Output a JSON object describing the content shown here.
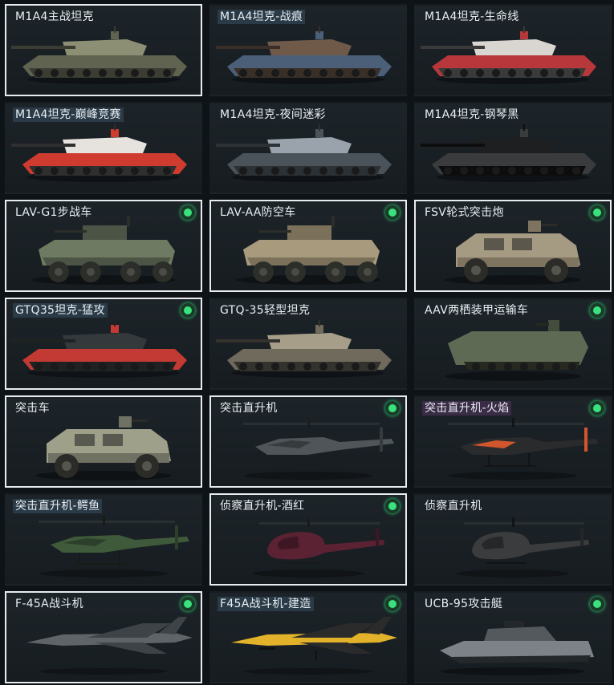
{
  "vehicles": [
    {
      "name": "M1A4主战坦克",
      "owned": true,
      "kind": "tank",
      "colors": [
        "#8c8f74",
        "#5f6350",
        "#3b3d33"
      ]
    },
    {
      "name": "M1A4坦克-战痕",
      "owned": false,
      "tag": "blue",
      "kind": "tank",
      "colors": [
        "#6f5a4a",
        "#4b5f78",
        "#3a2f28"
      ]
    },
    {
      "name": "M1A4坦克-生命线",
      "owned": false,
      "kind": "tank",
      "colors": [
        "#d9d5d0",
        "#b8373a",
        "#3a3a3a"
      ]
    },
    {
      "name": "M1A4坦克-巅峰竞赛",
      "owned": false,
      "tag": "blue",
      "kind": "tank",
      "colors": [
        "#e6e3df",
        "#cf3b2e",
        "#2f2f2f"
      ]
    },
    {
      "name": "M1A4坦克-夜间迷彩",
      "owned": false,
      "kind": "tank",
      "colors": [
        "#9aa3ab",
        "#4b535a",
        "#2c3136"
      ]
    },
    {
      "name": "M1A4坦克-钢琴黑",
      "owned": false,
      "kind": "tank",
      "colors": [
        "#1e1f20",
        "#3a3b3c",
        "#0d0d0e"
      ]
    },
    {
      "name": "LAV-G1步战车",
      "owned": true,
      "badge": true,
      "kind": "apc",
      "colors": [
        "#6f7a62",
        "#4c5545",
        "#2b2e29"
      ]
    },
    {
      "name": "LAV-AA防空车",
      "owned": true,
      "badge": true,
      "kind": "apc",
      "colors": [
        "#a89a7c",
        "#7b705a",
        "#2b2e29"
      ]
    },
    {
      "name": "FSV轮式突击炮",
      "owned": true,
      "badge": true,
      "kind": "armored-car",
      "colors": [
        "#a59a82",
        "#7e745f",
        "#2b2b28"
      ]
    },
    {
      "name": "GTQ35坦克-猛攻",
      "owned": true,
      "badge": true,
      "tag": "blue",
      "kind": "tank",
      "colors": [
        "#343a3c",
        "#c23a33",
        "#1f2223"
      ]
    },
    {
      "name": "GTQ-35轻型坦克",
      "owned": false,
      "kind": "tank",
      "colors": [
        "#a69e89",
        "#6f6a5c",
        "#33322d"
      ]
    },
    {
      "name": "AAV两栖装甲运输车",
      "owned": false,
      "badge": true,
      "kind": "amphib",
      "colors": [
        "#5f6a55",
        "#434c3d",
        "#26291f"
      ]
    },
    {
      "name": "突击车",
      "owned": true,
      "kind": "armored-car",
      "colors": [
        "#9ea08a",
        "#6f7263",
        "#2b2b28"
      ]
    },
    {
      "name": "突击直升机",
      "owned": true,
      "badge": true,
      "kind": "heli",
      "colors": [
        "#4f5559",
        "#363b3e",
        "#1b1e20"
      ]
    },
    {
      "name": "突击直升机-火焰",
      "owned": false,
      "badge": true,
      "tag": "purple",
      "kind": "heli",
      "colors": [
        "#2a2b2c",
        "#d1552d",
        "#131415"
      ]
    },
    {
      "name": "突击直升机-鳄鱼",
      "owned": false,
      "tag": "blue",
      "kind": "heli",
      "colors": [
        "#3f5a3a",
        "#2c3f2a",
        "#161c15"
      ]
    },
    {
      "name": "侦察直升机-酒红",
      "owned": true,
      "badge": true,
      "kind": "scout",
      "colors": [
        "#5a2233",
        "#3e1725",
        "#1a1a1a"
      ]
    },
    {
      "name": "侦察直升机",
      "owned": false,
      "kind": "scout",
      "colors": [
        "#3a3c3d",
        "#252728",
        "#121314"
      ]
    },
    {
      "name": "F-45A战斗机",
      "owned": true,
      "badge": true,
      "kind": "jet",
      "colors": [
        "#5e6468",
        "#3e4347",
        "#1c1f21"
      ]
    },
    {
      "name": "F45A战斗机-建造",
      "owned": false,
      "badge": true,
      "tag": "blue",
      "kind": "jet",
      "colors": [
        "#e2b22a",
        "#2b2b2b",
        "#111111"
      ]
    },
    {
      "name": "UCB-95攻击艇",
      "owned": false,
      "badge": true,
      "kind": "boat",
      "colors": [
        "#7c8288",
        "#54595e",
        "#25282a"
      ]
    }
  ]
}
